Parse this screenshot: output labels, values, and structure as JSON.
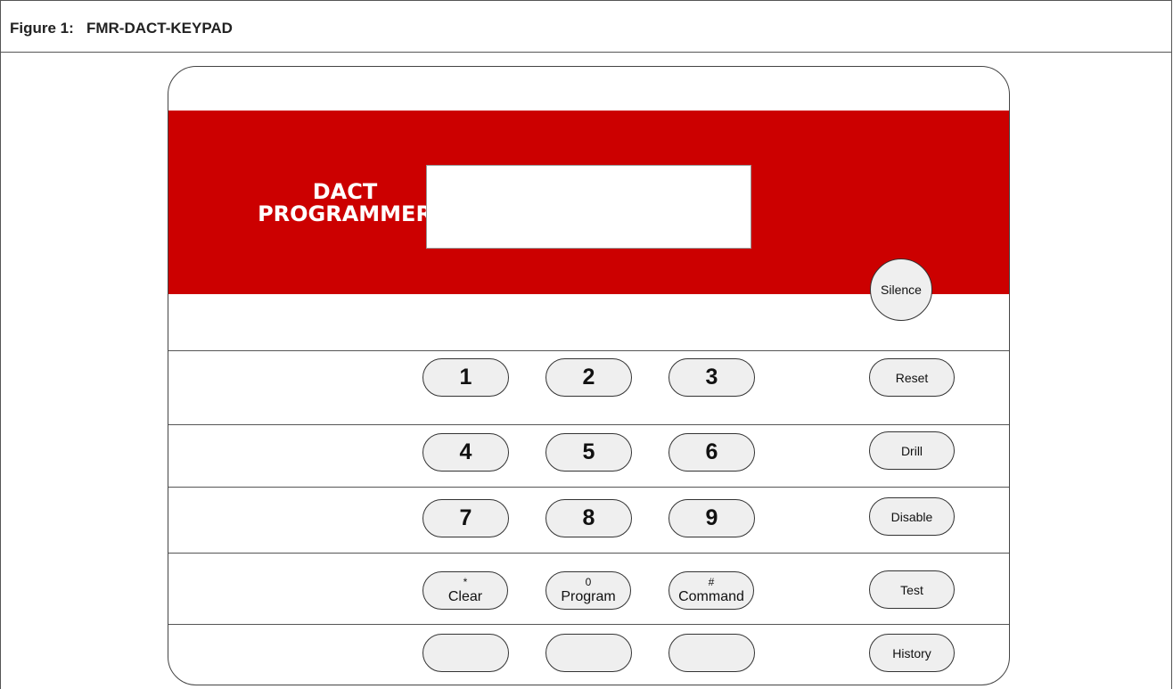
{
  "figure": {
    "caption": "Figure 1:   FMR-DACT-KEYPAD"
  },
  "panel": {
    "brand_line1": "DACT",
    "brand_line2": "PROGRAMMER",
    "colors": {
      "band": "#cc0000",
      "key_fill": "#efefef"
    }
  },
  "keys": {
    "k1": "1",
    "k2": "2",
    "k3": "3",
    "k4": "4",
    "k5": "5",
    "k6": "6",
    "k7": "7",
    "k8": "8",
    "k9": "9",
    "clear_small": "*",
    "clear_main": "Clear",
    "program_small": "0",
    "program_main": "Program",
    "command_small": "#",
    "command_main": "Command"
  },
  "functions": {
    "silence": "Silence",
    "reset": "Reset",
    "drill": "Drill",
    "disable": "Disable",
    "test": "Test",
    "history": "History"
  }
}
